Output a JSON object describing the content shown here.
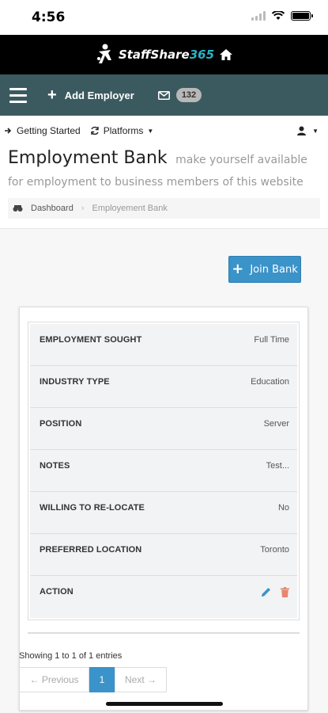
{
  "status": {
    "time": "4:56"
  },
  "brand": {
    "name_part1": "StaffShare",
    "name_part2": "365"
  },
  "navbar": {
    "add_employer": "Add Employer",
    "message_count": "132"
  },
  "subnav": {
    "getting_started": "Getting Started",
    "platforms": "Platforms"
  },
  "page": {
    "title": "Employment Bank",
    "subtitle": "make yourself available for employment to business members of this website"
  },
  "breadcrumb": {
    "home": "Dashboard",
    "current": "Employement Bank"
  },
  "actions": {
    "join_bank": "Join Bank"
  },
  "details": {
    "rows": [
      {
        "label": "EMPLOYMENT SOUGHT",
        "value": "Full Time"
      },
      {
        "label": "INDUSTRY TYPE",
        "value": "Education"
      },
      {
        "label": "POSITION",
        "value": "Server"
      },
      {
        "label": "NOTES",
        "value": "Test..."
      },
      {
        "label": "WILLING TO RE-LOCATE",
        "value": "No"
      },
      {
        "label": "PREFERRED LOCATION",
        "value": "Toronto"
      },
      {
        "label": "ACTION",
        "value": ""
      }
    ]
  },
  "pagination": {
    "info": "Showing 1 to 1 of 1 entries",
    "previous": "← Previous",
    "current": "1",
    "next": "Next →"
  },
  "colors": {
    "primary": "#3a93c9",
    "navbar": "#3b5a5f",
    "brand_bar": "#000000",
    "delete": "#e8866d"
  }
}
